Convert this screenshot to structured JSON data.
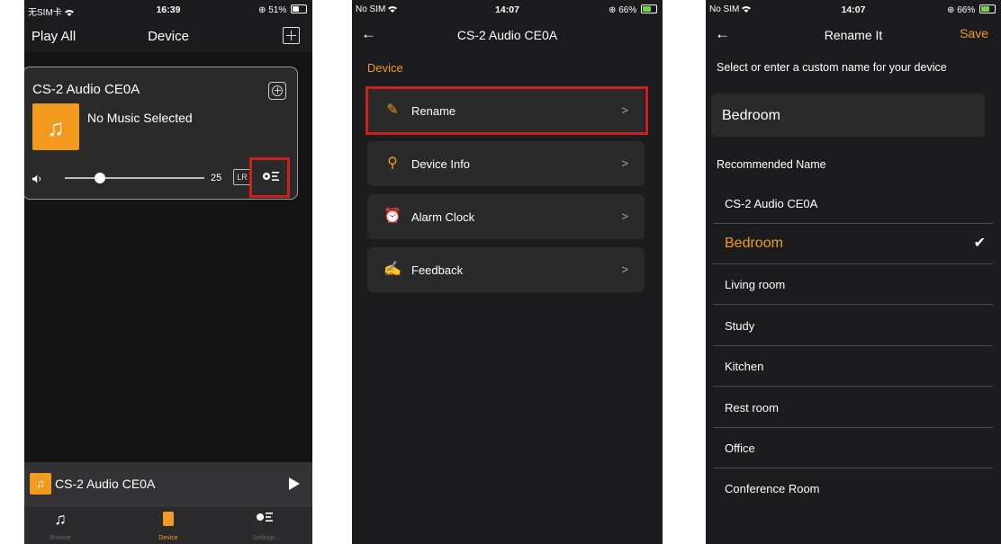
{
  "screen1": {
    "status": {
      "carrier": "无SIM卡",
      "time": "16:39",
      "battery": "51%"
    },
    "header": {
      "play_all": "Play All",
      "title": "Device"
    },
    "card": {
      "device_name": "CS-2 Audio CE0A",
      "track": "No Music Selected",
      "volume_label": "25",
      "volume_fraction": 0.25,
      "lr": "LR"
    },
    "mini_player": {
      "title": "CS-2 Audio CE0A"
    },
    "tabs": [
      {
        "label": "Browse",
        "icon": "music-note-icon"
      },
      {
        "label": "Device",
        "icon": "speaker-icon"
      },
      {
        "label": "Settings",
        "icon": "settings-sliders-icon"
      }
    ]
  },
  "screen2": {
    "status": {
      "carrier": "No SIM",
      "time": "14:07",
      "battery": "66%"
    },
    "title": "CS-2 Audio CE0A",
    "section": "Device",
    "menu": [
      {
        "label": "Rename",
        "icon": "pencil-icon"
      },
      {
        "label": "Device Info",
        "icon": "person-icon"
      },
      {
        "label": "Alarm Clock",
        "icon": "alarm-clock-icon"
      },
      {
        "label": "Feedback",
        "icon": "feedback-icon"
      }
    ]
  },
  "screen3": {
    "status": {
      "carrier": "No SIM",
      "time": "14:07",
      "battery": "66%"
    },
    "title": "Rename It",
    "save": "Save",
    "hint": "Select or enter a custom name for your device",
    "current_name": "Bedroom",
    "recommended_label": "Recommended Name",
    "options": [
      "CS-2 Audio CE0A",
      "Bedroom",
      "Living room",
      "Study",
      "Kitchen",
      "Rest room",
      "Office",
      "Conference Room"
    ],
    "selected": "Bedroom"
  },
  "colors": {
    "accent": "#f29a1d",
    "highlight": "#cc1f1f",
    "background": "#1c1c1e"
  }
}
